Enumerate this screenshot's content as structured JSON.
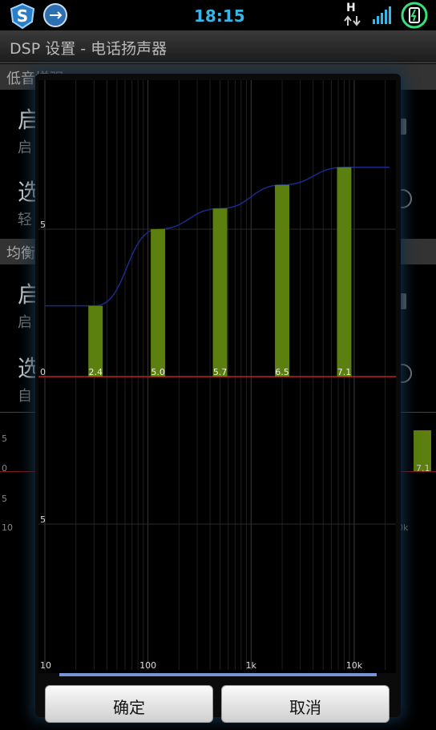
{
  "status_bar": {
    "time": "18:15",
    "network_type": "H",
    "icons": [
      "s-app-icon",
      "usb-icon",
      "network-arrows-icon",
      "signal-icon",
      "battery-charging-icon"
    ]
  },
  "background_screen": {
    "title": "DSP 设置 - 电话扬声器",
    "section_bass": "低音增强",
    "item_enable_1_title": "启",
    "item_enable_1_sub": "启",
    "item_select_1_title": "选",
    "item_select_1_sub": "轻",
    "section_eq": "均衡",
    "item_enable_2_title": "启",
    "item_enable_2_sub": "启",
    "item_select_2_title": "选",
    "item_select_2_sub": "自",
    "mini_chart": {
      "y_labels": [
        "5",
        "0",
        "5"
      ],
      "x_left": "10",
      "x_right": "0k",
      "right_bar_label": "7.1"
    }
  },
  "dialog": {
    "confirm_label": "确定",
    "cancel_label": "取消"
  },
  "chart_data": {
    "type": "bar",
    "x_scale": "log",
    "xlim": [
      10,
      22000
    ],
    "ylim": [
      -10,
      10
    ],
    "x_tick_labels": [
      "10",
      "100",
      "1k",
      "10k"
    ],
    "y_tick_labels": [
      "5",
      "0",
      "5"
    ],
    "grid": true,
    "zero_line_color": "#c0201e",
    "bar_color": "#5c800f",
    "curve_color": "#1a2b8a",
    "bars": [
      {
        "freq": 31,
        "value": 2.4,
        "label": "2.4"
      },
      {
        "freq": 125,
        "value": 5.0,
        "label": "5.0"
      },
      {
        "freq": 500,
        "value": 5.7,
        "label": "5.7"
      },
      {
        "freq": 2000,
        "value": 6.5,
        "label": "6.5"
      },
      {
        "freq": 8000,
        "value": 7.1,
        "label": "7.1"
      }
    ]
  }
}
